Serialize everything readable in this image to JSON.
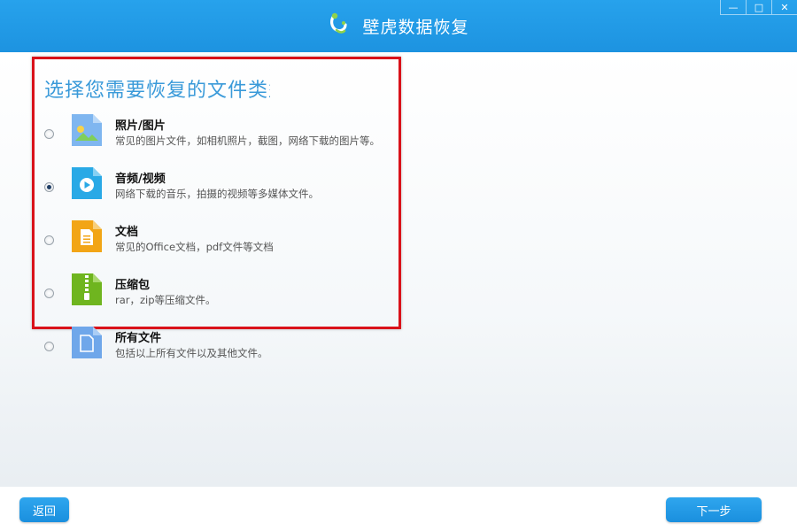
{
  "window": {
    "title": "壁虎数据恢复",
    "controls": {
      "minimize": "—",
      "maximize": "□",
      "close": "✕"
    }
  },
  "main": {
    "heading": "选择您需要恢复的文件类型",
    "options": [
      {
        "title": "照片/图片",
        "description": "常见的图片文件，如相机照片，截图，网络下载的图片等。",
        "selected": false,
        "icon": "image-file-icon",
        "color": "#7fb6f0"
      },
      {
        "title": "音频/视频",
        "description": "网络下载的音乐，拍摄的视频等多媒体文件。",
        "selected": true,
        "icon": "media-file-icon",
        "color": "#29a9e6"
      },
      {
        "title": "文档",
        "description": "常见的Office文档，pdf文件等文档",
        "selected": false,
        "icon": "document-file-icon",
        "color": "#f2a516"
      },
      {
        "title": "压缩包",
        "description": "rar，zip等压缩文件。",
        "selected": false,
        "icon": "archive-file-icon",
        "color": "#6fb51f"
      },
      {
        "title": "所有文件",
        "description": "包括以上所有文件以及其他文件。",
        "selected": false,
        "icon": "generic-file-icon",
        "color": "#6fa7ea"
      }
    ]
  },
  "footer": {
    "back_label": "返回",
    "next_label": "下一步"
  },
  "colors": {
    "accent": "#1f95e2",
    "highlight_border": "#d9121a"
  }
}
